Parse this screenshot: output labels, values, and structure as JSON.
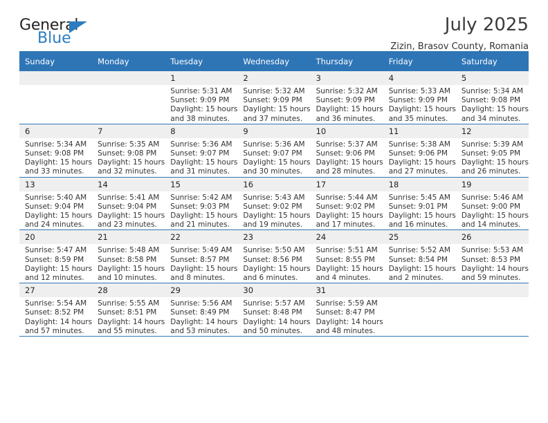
{
  "brand": {
    "name_top": "General",
    "name_bottom": "Blue",
    "triangle_color": "#2b7cc0"
  },
  "header": {
    "title": "July 2025",
    "subtitle": "Zizin, Brasov County, Romania"
  },
  "theme": {
    "header_blue": "#2e75b6",
    "daynum_gray": "#efefef",
    "text": "#333333"
  },
  "calendar": {
    "weekday_headers": [
      "Sunday",
      "Monday",
      "Tuesday",
      "Wednesday",
      "Thursday",
      "Friday",
      "Saturday"
    ],
    "labels": {
      "sunrise": "Sunrise:",
      "sunset": "Sunset:",
      "daylight": "Daylight:"
    },
    "weeks": [
      [
        {
          "day": "",
          "lines": []
        },
        {
          "day": "",
          "lines": []
        },
        {
          "day": "1",
          "lines": [
            "Sunrise: 5:31 AM",
            "Sunset: 9:09 PM",
            "Daylight: 15 hours",
            "and 38 minutes."
          ]
        },
        {
          "day": "2",
          "lines": [
            "Sunrise: 5:32 AM",
            "Sunset: 9:09 PM",
            "Daylight: 15 hours",
            "and 37 minutes."
          ]
        },
        {
          "day": "3",
          "lines": [
            "Sunrise: 5:32 AM",
            "Sunset: 9:09 PM",
            "Daylight: 15 hours",
            "and 36 minutes."
          ]
        },
        {
          "day": "4",
          "lines": [
            "Sunrise: 5:33 AM",
            "Sunset: 9:09 PM",
            "Daylight: 15 hours",
            "and 35 minutes."
          ]
        },
        {
          "day": "5",
          "lines": [
            "Sunrise: 5:34 AM",
            "Sunset: 9:08 PM",
            "Daylight: 15 hours",
            "and 34 minutes."
          ]
        }
      ],
      [
        {
          "day": "6",
          "lines": [
            "Sunrise: 5:34 AM",
            "Sunset: 9:08 PM",
            "Daylight: 15 hours",
            "and 33 minutes."
          ]
        },
        {
          "day": "7",
          "lines": [
            "Sunrise: 5:35 AM",
            "Sunset: 9:08 PM",
            "Daylight: 15 hours",
            "and 32 minutes."
          ]
        },
        {
          "day": "8",
          "lines": [
            "Sunrise: 5:36 AM",
            "Sunset: 9:07 PM",
            "Daylight: 15 hours",
            "and 31 minutes."
          ]
        },
        {
          "day": "9",
          "lines": [
            "Sunrise: 5:36 AM",
            "Sunset: 9:07 PM",
            "Daylight: 15 hours",
            "and 30 minutes."
          ]
        },
        {
          "day": "10",
          "lines": [
            "Sunrise: 5:37 AM",
            "Sunset: 9:06 PM",
            "Daylight: 15 hours",
            "and 28 minutes."
          ]
        },
        {
          "day": "11",
          "lines": [
            "Sunrise: 5:38 AM",
            "Sunset: 9:06 PM",
            "Daylight: 15 hours",
            "and 27 minutes."
          ]
        },
        {
          "day": "12",
          "lines": [
            "Sunrise: 5:39 AM",
            "Sunset: 9:05 PM",
            "Daylight: 15 hours",
            "and 26 minutes."
          ]
        }
      ],
      [
        {
          "day": "13",
          "lines": [
            "Sunrise: 5:40 AM",
            "Sunset: 9:04 PM",
            "Daylight: 15 hours",
            "and 24 minutes."
          ]
        },
        {
          "day": "14",
          "lines": [
            "Sunrise: 5:41 AM",
            "Sunset: 9:04 PM",
            "Daylight: 15 hours",
            "and 23 minutes."
          ]
        },
        {
          "day": "15",
          "lines": [
            "Sunrise: 5:42 AM",
            "Sunset: 9:03 PM",
            "Daylight: 15 hours",
            "and 21 minutes."
          ]
        },
        {
          "day": "16",
          "lines": [
            "Sunrise: 5:43 AM",
            "Sunset: 9:02 PM",
            "Daylight: 15 hours",
            "and 19 minutes."
          ]
        },
        {
          "day": "17",
          "lines": [
            "Sunrise: 5:44 AM",
            "Sunset: 9:02 PM",
            "Daylight: 15 hours",
            "and 17 minutes."
          ]
        },
        {
          "day": "18",
          "lines": [
            "Sunrise: 5:45 AM",
            "Sunset: 9:01 PM",
            "Daylight: 15 hours",
            "and 16 minutes."
          ]
        },
        {
          "day": "19",
          "lines": [
            "Sunrise: 5:46 AM",
            "Sunset: 9:00 PM",
            "Daylight: 15 hours",
            "and 14 minutes."
          ]
        }
      ],
      [
        {
          "day": "20",
          "lines": [
            "Sunrise: 5:47 AM",
            "Sunset: 8:59 PM",
            "Daylight: 15 hours",
            "and 12 minutes."
          ]
        },
        {
          "day": "21",
          "lines": [
            "Sunrise: 5:48 AM",
            "Sunset: 8:58 PM",
            "Daylight: 15 hours",
            "and 10 minutes."
          ]
        },
        {
          "day": "22",
          "lines": [
            "Sunrise: 5:49 AM",
            "Sunset: 8:57 PM",
            "Daylight: 15 hours",
            "and 8 minutes."
          ]
        },
        {
          "day": "23",
          "lines": [
            "Sunrise: 5:50 AM",
            "Sunset: 8:56 PM",
            "Daylight: 15 hours",
            "and 6 minutes."
          ]
        },
        {
          "day": "24",
          "lines": [
            "Sunrise: 5:51 AM",
            "Sunset: 8:55 PM",
            "Daylight: 15 hours",
            "and 4 minutes."
          ]
        },
        {
          "day": "25",
          "lines": [
            "Sunrise: 5:52 AM",
            "Sunset: 8:54 PM",
            "Daylight: 15 hours",
            "and 2 minutes."
          ]
        },
        {
          "day": "26",
          "lines": [
            "Sunrise: 5:53 AM",
            "Sunset: 8:53 PM",
            "Daylight: 14 hours",
            "and 59 minutes."
          ]
        }
      ],
      [
        {
          "day": "27",
          "lines": [
            "Sunrise: 5:54 AM",
            "Sunset: 8:52 PM",
            "Daylight: 14 hours",
            "and 57 minutes."
          ]
        },
        {
          "day": "28",
          "lines": [
            "Sunrise: 5:55 AM",
            "Sunset: 8:51 PM",
            "Daylight: 14 hours",
            "and 55 minutes."
          ]
        },
        {
          "day": "29",
          "lines": [
            "Sunrise: 5:56 AM",
            "Sunset: 8:49 PM",
            "Daylight: 14 hours",
            "and 53 minutes."
          ]
        },
        {
          "day": "30",
          "lines": [
            "Sunrise: 5:57 AM",
            "Sunset: 8:48 PM",
            "Daylight: 14 hours",
            "and 50 minutes."
          ]
        },
        {
          "day": "31",
          "lines": [
            "Sunrise: 5:59 AM",
            "Sunset: 8:47 PM",
            "Daylight: 14 hours",
            "and 48 minutes."
          ]
        },
        {
          "day": "",
          "lines": []
        },
        {
          "day": "",
          "lines": []
        }
      ]
    ]
  }
}
